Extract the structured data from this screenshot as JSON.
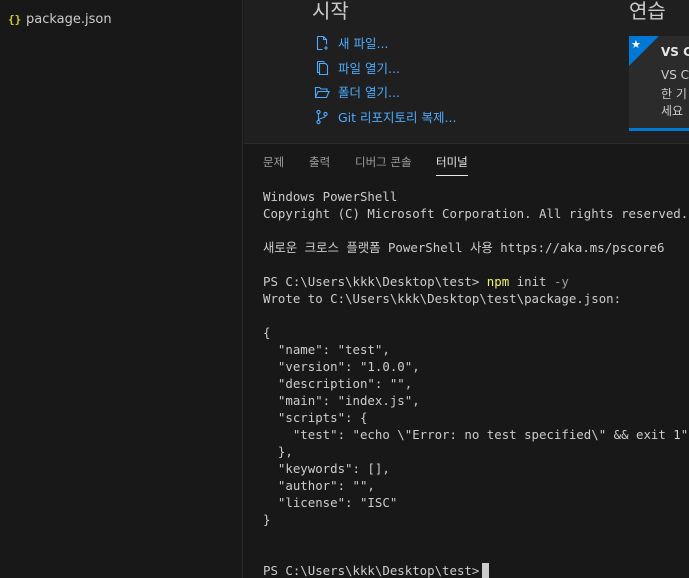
{
  "explorer": {
    "files": [
      {
        "icon": "{}",
        "name": "package.json"
      }
    ]
  },
  "welcome": {
    "start_title": "시작",
    "actions": [
      {
        "icon": "new-file-icon",
        "label": "새 파일..."
      },
      {
        "icon": "open-file-icon",
        "label": "파일 열기..."
      },
      {
        "icon": "open-folder-icon",
        "label": "폴더 열기..."
      },
      {
        "icon": "git-clone-icon",
        "label": "Git 리포지토리 복제..."
      }
    ],
    "walkthrough_title": "연습",
    "card": {
      "icon": "star-icon",
      "title": "VS C",
      "lines": [
        "VS C",
        "한 기",
        "세요"
      ]
    }
  },
  "panel": {
    "tabs": [
      {
        "label": "문제",
        "active": false
      },
      {
        "label": "출력",
        "active": false
      },
      {
        "label": "디버그 콘솔",
        "active": false
      },
      {
        "label": "터미널",
        "active": true
      }
    ]
  },
  "terminal": {
    "header": [
      "Windows PowerShell",
      "Copyright (C) Microsoft Corporation. All rights reserved.",
      "",
      "새로운 크로스 플랫폼 PowerShell 사용 https://aka.ms/pscore6",
      ""
    ],
    "command": {
      "prompt": "PS C:\\Users\\kkk\\Desktop\\test> ",
      "program": "npm",
      "args": " init ",
      "flag": "-y"
    },
    "output": [
      "Wrote to C:\\Users\\kkk\\Desktop\\test\\package.json:",
      "",
      "{",
      "  \"name\": \"test\",",
      "  \"version\": \"1.0.0\",",
      "  \"description\": \"\",",
      "  \"main\": \"index.js\",",
      "  \"scripts\": {",
      "    \"test\": \"echo \\\"Error: no test specified\\\" && exit 1\"",
      "  },",
      "  \"keywords\": [],",
      "  \"author\": \"\",",
      "  \"license\": \"ISC\"",
      "}",
      "",
      ""
    ],
    "final_prompt": "PS C:\\Users\\kkk\\Desktop\\test>"
  },
  "colors": {
    "accent": "#0078d4",
    "link": "#4daafc",
    "npm_command": "#f1f16a",
    "json_icon": "#cbcb41"
  }
}
